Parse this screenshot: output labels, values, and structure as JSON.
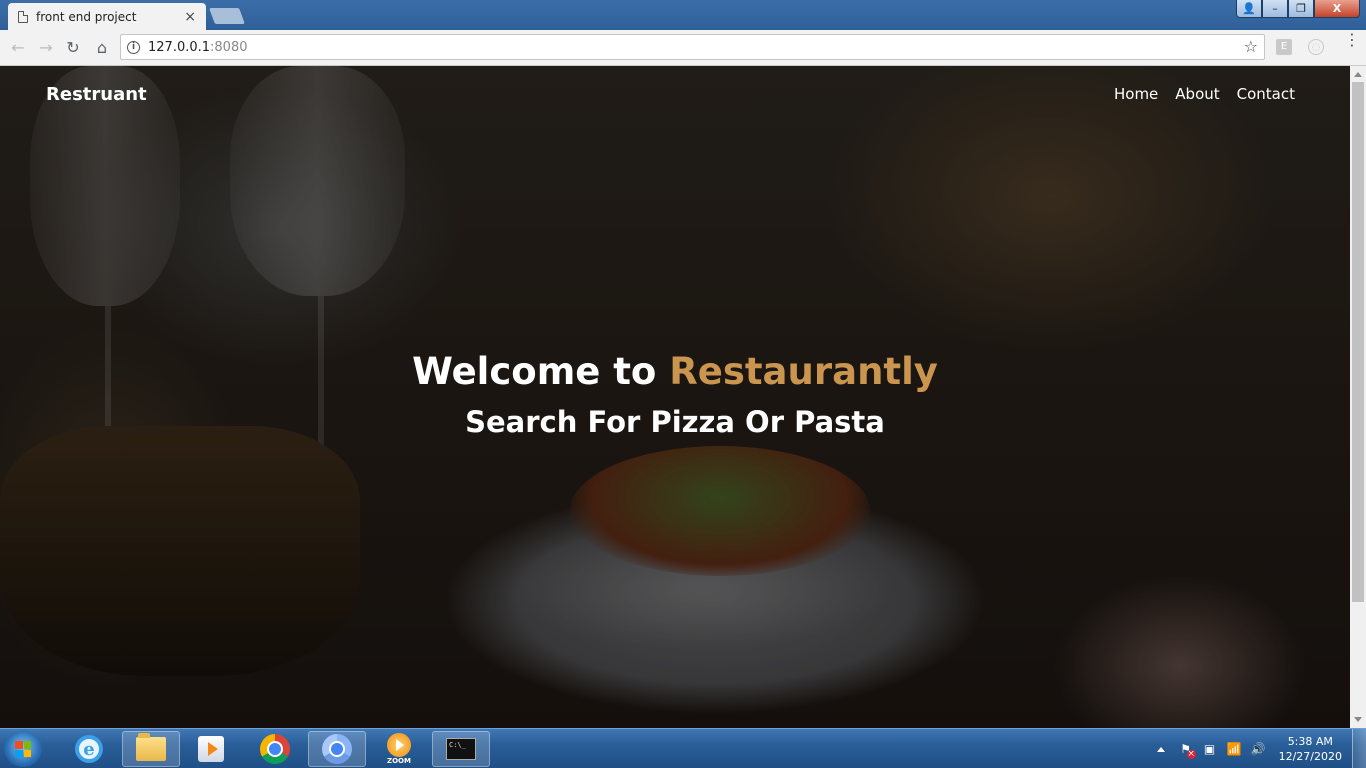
{
  "browser": {
    "tab_title": "front end project",
    "tab_close": "×",
    "url_host": "127.0.0.1",
    "url_port": ":8080",
    "info_glyph": "i",
    "star_glyph": "☆",
    "ext1_label": "E",
    "ext2_label": "◌",
    "menu_glyph": "⋮",
    "back_glyph": "←",
    "forward_glyph": "→",
    "reload_glyph": "↻",
    "home_glyph": "⌂",
    "icons": {
      "back": "arrow-left-icon",
      "forward": "arrow-right-icon",
      "reload": "reload-icon",
      "home": "home-icon",
      "info": "info-icon",
      "bookmark": "star-icon",
      "menu": "more-vertical-icon"
    }
  },
  "window_controls": {
    "user": "👤",
    "minimize": "–",
    "maximize": "❐",
    "close": "X"
  },
  "site": {
    "brand": "Restruant",
    "nav": [
      "Home",
      "About",
      "Contact"
    ],
    "hero": {
      "welcome": "Welcome to",
      "name": "Restaurantly",
      "subtitle": "Search For Pizza Or Pasta"
    },
    "colors": {
      "accent": "#c9954f",
      "text": "#ffffff"
    }
  },
  "taskbar": {
    "ie_glyph": "e",
    "zoom_label": "ZOOM",
    "cmd_text": "C:\\_",
    "apps": [
      "internet-explorer",
      "file-explorer",
      "media-player",
      "chrome",
      "chrome-active",
      "zoom",
      "command-prompt"
    ],
    "tray": {
      "speaker": "🔊",
      "network": "📶",
      "device": "▣"
    },
    "clock_time": "5:38 AM",
    "clock_date": "12/27/2020"
  }
}
